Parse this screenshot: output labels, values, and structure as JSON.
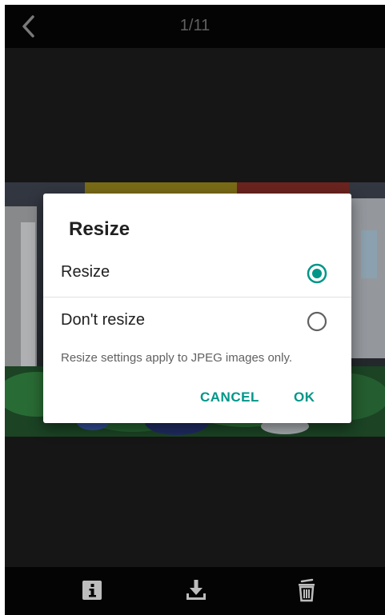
{
  "header": {
    "page_counter": "1/11"
  },
  "dialog": {
    "title": "Resize",
    "options": [
      {
        "label": "Resize",
        "selected": true
      },
      {
        "label": "Don't resize",
        "selected": false
      }
    ],
    "note": "Resize settings apply to JPEG images only.",
    "cancel_label": "CANCEL",
    "ok_label": "OK"
  },
  "toolbar": {
    "icons": [
      "info-icon",
      "download-icon",
      "trash-icon"
    ]
  },
  "colors": {
    "accent": "#009688",
    "background": "#1a1a1a",
    "bar": "#050505"
  }
}
